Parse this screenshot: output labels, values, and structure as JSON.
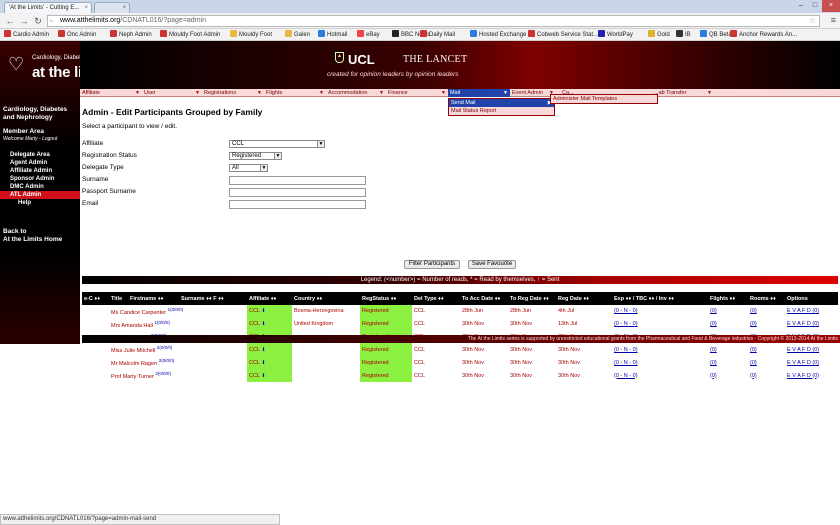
{
  "browser": {
    "tabs": [
      {
        "title": "'At the Limits' - Cutting E..."
      },
      {
        "title": ""
      }
    ],
    "url_domain": "www.atthelimits.org",
    "url_rest": "/CDNATL016/?page=admin",
    "bookmarks": [
      "Cardio Admin",
      "Onc Admin",
      "Neph Admin",
      "Mouldy Foot Admin",
      "Mouldy Foot",
      "Galen",
      "Hotmail",
      "eBay",
      "BBC News",
      "Daily Mail",
      "Hosted Exchange",
      "Cobweb Service Stat...",
      "WorldPay",
      "Gold",
      "IB",
      "QB Beta",
      "Anchor Rewards An..."
    ],
    "status_url": "www.atthelimits.org/CDNATL016/?page=admin-mail-send"
  },
  "site": {
    "logo_small": "Cardiology, Diabetes & Nephrology",
    "logo_big": "at the limits",
    "ucl_text": "UCL",
    "lancet_text": "THE LANCET",
    "tagline": "created for opinion leaders by opinion leaders",
    "sidebar_heading": "Cardiology, Diabetes and Nephrology",
    "member_area": "Member Area",
    "welcome": "Welcome Marty - Logout",
    "side_links": [
      "Delegate Area",
      "Agent Admin",
      "Affiliate Admin",
      "Sponsor Admin",
      "DMC Admin",
      "ATL Admin",
      "Help"
    ],
    "back_line1": "Back to",
    "back_line2": "At the Limits Home",
    "footer": "The At the Limits series is supported by unrestricted educational grants from the Pharmaceutical and Food & Beverage industries - Copyright © 2013-2014 At the Limits"
  },
  "menu": {
    "items": [
      "Affiliate",
      "User",
      "Registrations",
      "Flights",
      "Accommodation",
      "Finance",
      "Mail",
      "Event Admin",
      "Ca...",
      "...ab Transfer"
    ],
    "mail_dropdown": [
      "Send Mail",
      "Mail Status Report"
    ],
    "submenu": [
      "Administer Mail Templates"
    ]
  },
  "page": {
    "title": "Admin - Edit Participants Grouped by Family",
    "instruction": "Select a participant to view / edit.",
    "fields": {
      "affiliate_label": "Affiliate",
      "affiliate_value": "CCL",
      "reg_status_label": "Registration Status",
      "reg_status_value": "Registered",
      "delegate_type_label": "Delegate Type",
      "delegate_type_value": "All",
      "surname_label": "Surname",
      "passport_label": "Passport Surname",
      "email_label": "Email"
    },
    "filter_button": "Filter Participants",
    "save_button": "Save Favourite",
    "legend": "Legend: (<number>) = Number of reads, * = Read by themselves, ↑ = Sent"
  },
  "table": {
    "headers": [
      "e-C ♦♦",
      "Title",
      "Firstname ♦♦",
      "Surname ♦♦ F ♦♦",
      "Affiliate ♦♦",
      "Country ♦♦",
      "RegStatus ♦♦",
      "Del Type ♦♦",
      "To Acc Date ♦♦",
      "To Reg Date ♦♦",
      "Reg Date ♦♦",
      "Exp ♦♦ / TBC ♦♦ / Inv ♦♦",
      "Flights ♦♦",
      "Rooms ♦♦",
      "Options"
    ],
    "rows": [
      {
        "name": "Ms Candice Carpenter",
        "reads": "1(0/0/0)",
        "affiliate": "CCL",
        "country": "Bosnia-Herzegovina",
        "status": "Registered",
        "deltype": "CCL",
        "acc": "28th Jun",
        "reg": "28th Jun",
        "regdate": "4th Jul",
        "exp": "(0 - N - 0)",
        "flights": "(0)",
        "rooms": "(0)",
        "options": "E V A F D (0)"
      },
      {
        "name": "Mrs Amanda Hall",
        "reads": "1(0/0/0)",
        "affiliate": "CCL",
        "country": "United Kingdom",
        "status": "Registered",
        "deltype": "CCL",
        "acc": "30th Nov",
        "reg": "30th Nov",
        "regdate": "13th Jul",
        "exp": "(0 - N - 0)",
        "flights": "(0)",
        "rooms": "(0)",
        "options": "E V A F D (0)"
      },
      {
        "name": "Mr David Jones",
        "reads": "2(0/0/0)",
        "affiliate": "CCL",
        "country": "",
        "status": "Registered",
        "deltype": "CCL",
        "acc": "30th Nov",
        "reg": "30th Nov",
        "regdate": "30th Nov",
        "exp": "(0 - N - 0)",
        "flights": "(0)",
        "rooms": "(0)",
        "options": "E V A F D (0)"
      },
      {
        "name": "Miss Julie Mitchell",
        "reads": "2(0/0/0)",
        "affiliate": "CCL",
        "country": "",
        "status": "Registered",
        "deltype": "CCL",
        "acc": "30th Nov",
        "reg": "30th Nov",
        "regdate": "30th Nov",
        "exp": "(0 - N - 0)",
        "flights": "(0)",
        "rooms": "(0)",
        "options": "E V A F D (0)"
      },
      {
        "name": "Mr Malcolm Ragen",
        "reads": "2(0/0/0)",
        "affiliate": "CCL",
        "country": "",
        "status": "Registered",
        "deltype": "CCL",
        "acc": "30th Nov",
        "reg": "30th Nov",
        "regdate": "30th Nov",
        "exp": "(0 - N - 0)",
        "flights": "(0)",
        "rooms": "(0)",
        "options": "E V A F D (0)"
      },
      {
        "name": "Prof Marty Turner",
        "reads": "2(0/0/0)",
        "affiliate": "CCL",
        "country": "",
        "status": "Registered",
        "deltype": "CCL",
        "acc": "30th Nov",
        "reg": "30th Nov",
        "regdate": "30th Nov",
        "exp": "(0 - N - 0)",
        "flights": "(0)",
        "rooms": "(0)",
        "options": "E V A F D (0)"
      }
    ]
  },
  "colors": {
    "accent_red": "#a00000",
    "menu_bg": "#f8d8d8",
    "highlight_green": "#8cf040",
    "selected_blue": "#2244aa"
  }
}
